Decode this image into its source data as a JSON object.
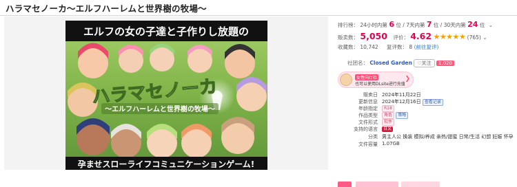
{
  "product": {
    "title": "ハラマセノーカ～エルフハーレムと世界樹の牧場～"
  },
  "banner": {
    "headline": "エルフの女の子達と子作りし放題の",
    "logo": "ハラマセノーカ",
    "logo_sub": "～エルフハーレムと世界樹の牧場～",
    "tagline": "孕ませスローライフコミュニケーションゲーム!"
  },
  "ranking": {
    "label": "排行榜：",
    "h24_label": "24小时内第",
    "h24_value": "6",
    "h24_unit": "位",
    "d7_label": "7天内第",
    "d7_value": "7",
    "d7_unit": "位",
    "d30_label": "30天内第",
    "d30_value": "24",
    "d30_unit": "位"
  },
  "sales": {
    "label": "贩卖数：",
    "value": "5,050",
    "rating_label": "评价：",
    "rating_value": "4.62",
    "rating_fraction": 0.924,
    "stars": "★★★★★",
    "rating_count": "(765)"
  },
  "favorites": {
    "label": "收藏数：",
    "value": "10,742",
    "review_label": "复评数：",
    "review_value": "8",
    "review_link": "(前往复评)"
  },
  "circle": {
    "label": "社团名：",
    "name": "Closed Garden",
    "follow": "♡关注",
    "follow_count": "1,020"
  },
  "promo": {
    "line1": "女性向け社",
    "line2": "也可以使用DLsite进行充值",
    "arrow": "❯"
  },
  "specs": [
    {
      "label": "贩卖日",
      "value": "2024年11月22日"
    },
    {
      "label": "更新信息",
      "value": "2024年12月16日",
      "tag": "查看记录"
    },
    {
      "label": "年龄指定",
      "tag": "R18"
    },
    {
      "label": "作品类型",
      "tags": [
        "角色",
        "策略"
      ]
    },
    {
      "label": "文件形式",
      "tag": "软件"
    },
    {
      "label": "支持的语言",
      "tag": "日文"
    },
    {
      "label": "分类",
      "value": "男主人公  换装  模拟/养成  亲热/甜蜜  日常/生活  幻想  妊娠  怀孕"
    },
    {
      "label": "文件容量",
      "value": "1.07GB"
    }
  ],
  "colors": {
    "accent": "#e4004f",
    "link": "#2f7ecf",
    "star": "#f5a000",
    "banner_bg": "#7fb348"
  }
}
